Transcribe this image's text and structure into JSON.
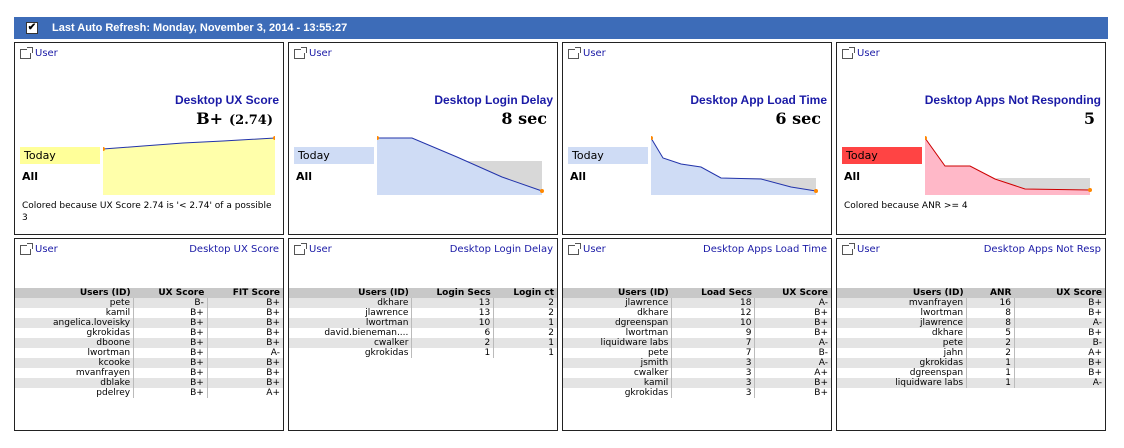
{
  "header": {
    "refresh_label": "Last Auto Refresh: Monday, November 3, 2014 - 13:55:27",
    "checkbox": "✔"
  },
  "kpis": [
    {
      "link": "User",
      "title": "Desktop UX Score",
      "value": "B+",
      "sub": "(2.74)",
      "today": "Today",
      "all": "All",
      "today_color": "#ffff99",
      "note": "Colored because UX Score 2.74 is '< 2.74' of a possible 3"
    },
    {
      "link": "User",
      "title": "Desktop Login Delay",
      "value": "8 sec",
      "sub": "",
      "today": "Today",
      "all": "All",
      "today_color": "#cfdcf5",
      "note": ""
    },
    {
      "link": "User",
      "title": "Desktop App Load Time",
      "value": "6 sec",
      "sub": "",
      "today": "Today",
      "all": "All",
      "today_color": "#cfdcf5",
      "note": ""
    },
    {
      "link": "User",
      "title": "Desktop Apps Not Responding",
      "value": "5",
      "sub": "",
      "today": "Today",
      "all": "All",
      "today_color": "#ff4444",
      "note": "Colored because ANR >= 4"
    }
  ],
  "tables": [
    {
      "link": "User",
      "title": "Desktop UX Score",
      "headers": [
        "Users (ID)",
        "UX Score",
        "FIT Score"
      ],
      "rows": [
        [
          "pete",
          "B-",
          "B+"
        ],
        [
          "kamil",
          "B+",
          "B+"
        ],
        [
          "angelica.loveisky",
          "B+",
          "B+"
        ],
        [
          "gkrokidas",
          "B+",
          "B+"
        ],
        [
          "dboone",
          "B+",
          "B+"
        ],
        [
          "lwortman",
          "B+",
          "A-"
        ],
        [
          "kcooke",
          "B+",
          "B+"
        ],
        [
          "mvanfrayen",
          "B+",
          "B+"
        ],
        [
          "dblake",
          "B+",
          "B+"
        ],
        [
          "pdelrey",
          "B+",
          "A+"
        ]
      ]
    },
    {
      "link": "User",
      "title": "Desktop Login Delay",
      "headers": [
        "Users (ID)",
        "Login Secs",
        "Login ct"
      ],
      "rows": [
        [
          "dkhare",
          "13",
          "2"
        ],
        [
          "jlawrence",
          "13",
          "2"
        ],
        [
          "lwortman",
          "10",
          "1"
        ],
        [
          "david.bieneman....",
          "6",
          "2"
        ],
        [
          "cwalker",
          "2",
          "1"
        ],
        [
          "gkrokidas",
          "1",
          "1"
        ]
      ]
    },
    {
      "link": "User",
      "title": "Desktop Apps Load Time",
      "headers": [
        "Users (ID)",
        "Load Secs",
        "UX Score"
      ],
      "rows": [
        [
          "jlawrence",
          "18",
          "A-"
        ],
        [
          "dkhare",
          "12",
          "B+"
        ],
        [
          "dgreenspan",
          "10",
          "B+"
        ],
        [
          "lwortman",
          "9",
          "B+"
        ],
        [
          "liquidware labs",
          "7",
          "A-"
        ],
        [
          "pete",
          "7",
          "B-"
        ],
        [
          "jsmith",
          "3",
          "A-"
        ],
        [
          "cwalker",
          "3",
          "A+"
        ],
        [
          "kamil",
          "3",
          "B+"
        ],
        [
          "gkrokidas",
          "3",
          "B+"
        ]
      ]
    },
    {
      "link": "User",
      "title": "Desktop Apps Not Resp",
      "headers": [
        "Users (ID)",
        "ANR",
        "UX Score"
      ],
      "rows": [
        [
          "mvanfrayen",
          "16",
          "B+"
        ],
        [
          "lwortman",
          "8",
          "B+"
        ],
        [
          "jlawrence",
          "8",
          "A-"
        ],
        [
          "dkhare",
          "5",
          "B+"
        ],
        [
          "pete",
          "2",
          "B-"
        ],
        [
          "jahn",
          "2",
          "A+"
        ],
        [
          "gkrokidas",
          "1",
          "B+"
        ],
        [
          "dgreenspan",
          "1",
          "B+"
        ],
        [
          "liquidware labs",
          "1",
          "A-"
        ]
      ]
    }
  ]
}
